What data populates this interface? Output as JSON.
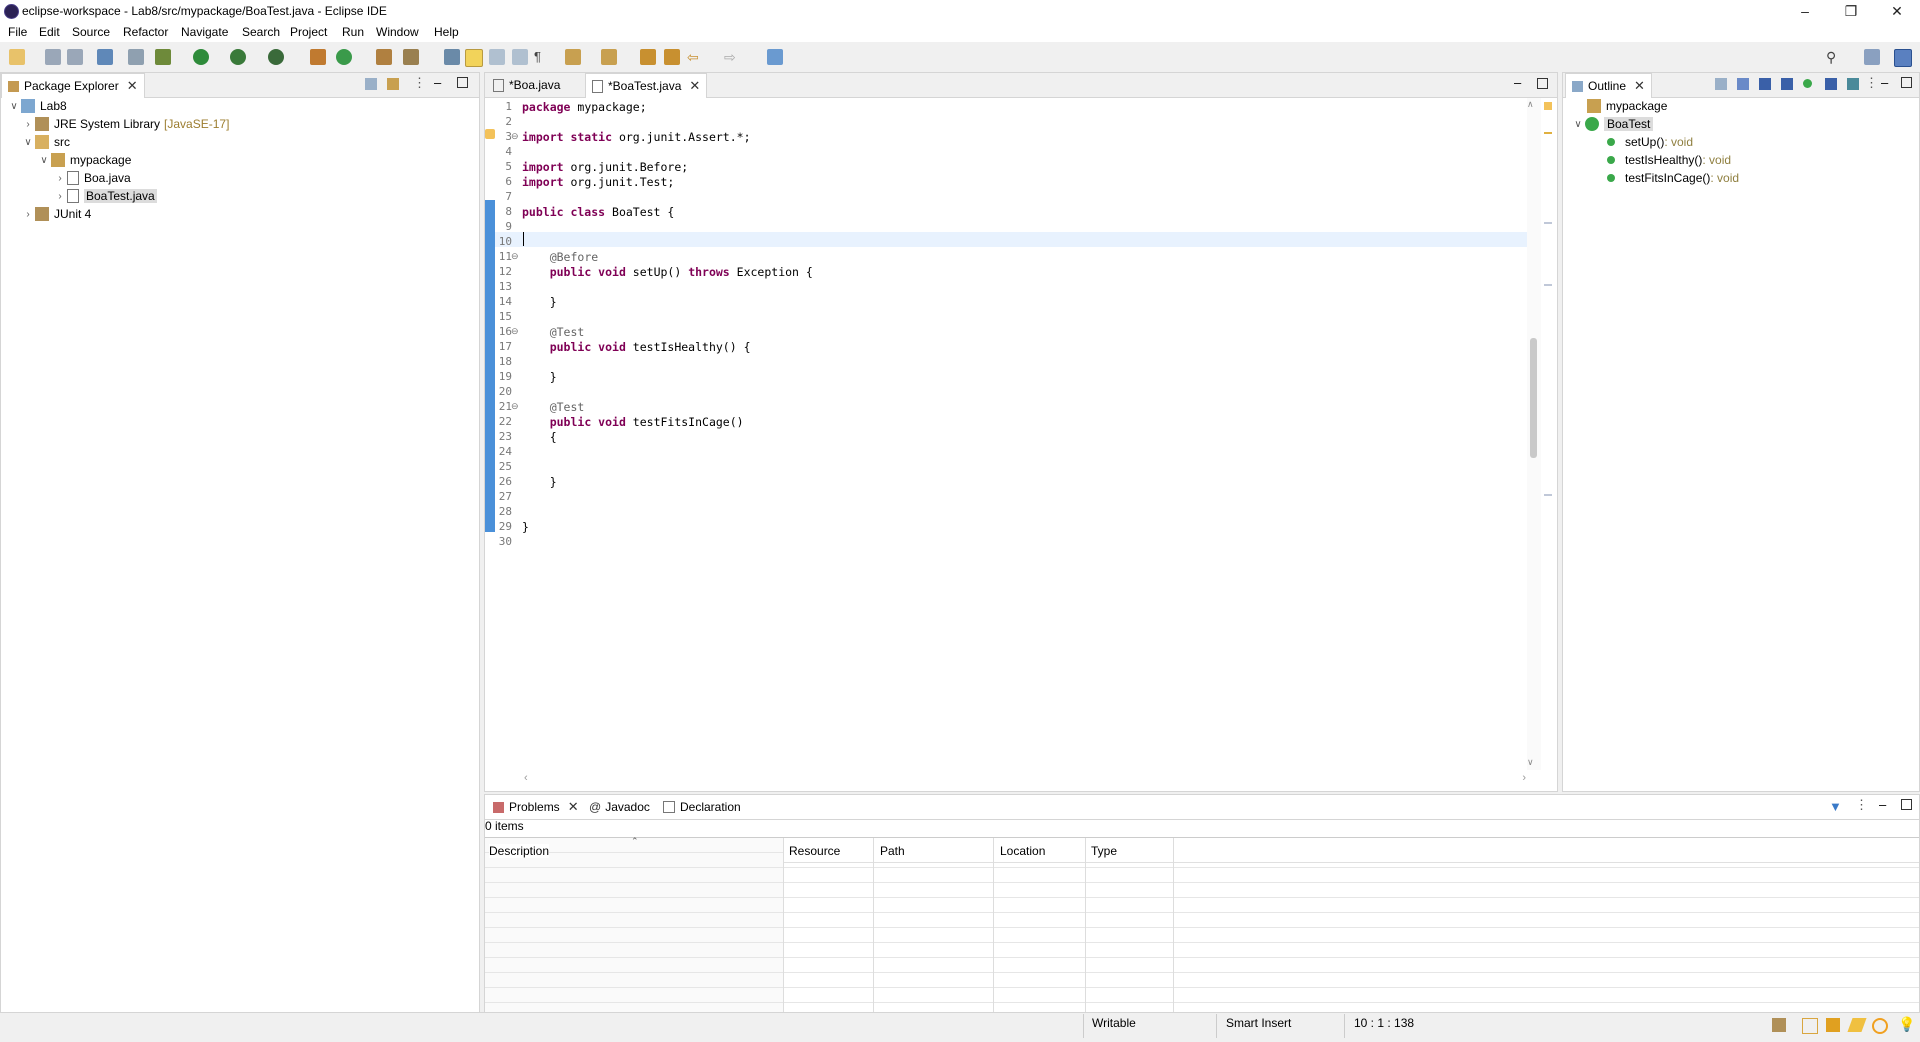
{
  "window": {
    "title": "eclipse-workspace - Lab8/src/mypackage/BoaTest.java - Eclipse IDE"
  },
  "menu": [
    "File",
    "Edit",
    "Source",
    "Refactor",
    "Navigate",
    "Search",
    "Project",
    "Run",
    "Window",
    "Help"
  ],
  "package_explorer": {
    "tab_label": "Package Explorer",
    "project": "Lab8",
    "jre": "JRE System Library",
    "jre_decoration": "[JavaSE-17]",
    "src": "src",
    "package": "mypackage",
    "files": [
      "Boa.java",
      "BoaTest.java"
    ],
    "junit": "JUnit 4"
  },
  "editor": {
    "tabs": [
      "*Boa.java",
      "*BoaTest.java"
    ],
    "lines": [
      {
        "n": "1",
        "html": "<span class='kw'>package</span> mypackage;"
      },
      {
        "n": "2",
        "html": ""
      },
      {
        "n": "3",
        "html": "<span class='kw'>import static</span> org.junit.Assert.*;"
      },
      {
        "n": "4",
        "html": ""
      },
      {
        "n": "5",
        "html": "<span class='kw'>import</span> org.junit.Before;"
      },
      {
        "n": "6",
        "html": "<span class='kw'>import</span> org.junit.Test;"
      },
      {
        "n": "7",
        "html": ""
      },
      {
        "n": "8",
        "html": "<span class='kw'>public class</span> BoaTest {"
      },
      {
        "n": "9",
        "html": ""
      },
      {
        "n": "10",
        "html": ""
      },
      {
        "n": "11",
        "html": "    <span class='ann'>@Before</span>"
      },
      {
        "n": "12",
        "html": "    <span class='kw'>public void</span> setUp() <span class='kw'>throws</span> Exception {"
      },
      {
        "n": "13",
        "html": ""
      },
      {
        "n": "14",
        "html": "    }"
      },
      {
        "n": "15",
        "html": ""
      },
      {
        "n": "16",
        "html": "    <span class='ann'>@Test</span>"
      },
      {
        "n": "17",
        "html": "    <span class='kw'>public void</span> testIsHealthy() {"
      },
      {
        "n": "18",
        "html": ""
      },
      {
        "n": "19",
        "html": "    }"
      },
      {
        "n": "20",
        "html": ""
      },
      {
        "n": "21",
        "html": "    <span class='ann'>@Test</span>"
      },
      {
        "n": "22",
        "html": "    <span class='kw'>public void</span> testFitsInCage()"
      },
      {
        "n": "23",
        "html": "    {"
      },
      {
        "n": "24",
        "html": ""
      },
      {
        "n": "25",
        "html": ""
      },
      {
        "n": "26",
        "html": "    }"
      },
      {
        "n": "27",
        "html": ""
      },
      {
        "n": "28",
        "html": ""
      },
      {
        "n": "29",
        "html": "}"
      },
      {
        "n": "30",
        "html": ""
      }
    ]
  },
  "outline": {
    "tab_label": "Outline",
    "package": "mypackage",
    "class": "BoaTest",
    "methods": [
      {
        "name": "setUp()",
        "type": " : void"
      },
      {
        "name": "testIsHealthy()",
        "type": " : void"
      },
      {
        "name": "testFitsInCage()",
        "type": " : void"
      }
    ]
  },
  "bottom": {
    "tabs": [
      "Problems",
      "Javadoc",
      "Declaration"
    ],
    "count": "0 items",
    "columns": [
      "Description",
      "Resource",
      "Path",
      "Location",
      "Type"
    ]
  },
  "statusbar": {
    "writable": "Writable",
    "insert_mode": "Smart Insert",
    "position": "10 : 1 : 138"
  },
  "colors": {
    "keyword": "#7f0055",
    "annotation": "#646464",
    "line_highlight": "#e8f2fe",
    "change_bar": "#4a90d9"
  }
}
